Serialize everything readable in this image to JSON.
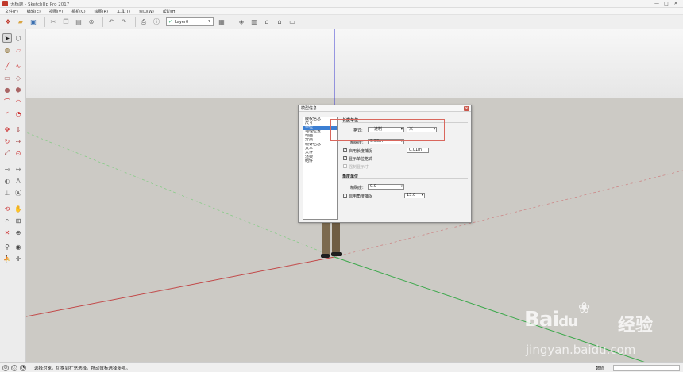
{
  "window": {
    "title": "无标题 - SketchUp Pro 2017",
    "controls": [
      "—",
      "□",
      "✕"
    ]
  },
  "menus": [
    "文件(F)",
    "编辑(E)",
    "视图(V)",
    "相机(C)",
    "绘图(R)",
    "工具(T)",
    "窗口(W)",
    "帮助(H)"
  ],
  "toolbar": {
    "layer": "Layer0"
  },
  "dialog": {
    "title": "模型信息",
    "close": "✕",
    "categories": [
      "版权信息",
      "尺寸",
      "单位",
      "地理位置",
      "动画",
      "分类",
      "统计信息",
      "文本",
      "文件",
      "渲染",
      "组件"
    ],
    "selected_category": "单位",
    "length_section": {
      "title": "长度单位",
      "format_label": "格式:",
      "format_value": "十进制",
      "unit_value": "米",
      "precision_label": "精确度:",
      "precision_value": "0.00m",
      "snap_label": "启用长度捕捉",
      "snap_value": "0.01m",
      "show_unit_label": "显示单位格式",
      "force_label": "强制显示寸"
    },
    "angle_section": {
      "title": "角度单位",
      "precision_label": "精确度:",
      "precision_value": "0.0",
      "snap_label": "启用角度捕捉",
      "snap_value": "15.0"
    }
  },
  "watermark": {
    "brand": "Bai",
    "brand_tail": "du",
    "suffix": "经验",
    "url": "jingyan.baidu.com"
  },
  "status": {
    "text": "选择对象。切换到扩充选择。拖动鼠标选择多项。",
    "measure_label": "数值",
    "measure_value": ""
  },
  "colors": {
    "red_axis": "#c24848",
    "green_axis": "#3aa84a",
    "blue_axis": "#3b3bd0",
    "selection": "#3c7fd3",
    "highlight": "#d9675d"
  }
}
